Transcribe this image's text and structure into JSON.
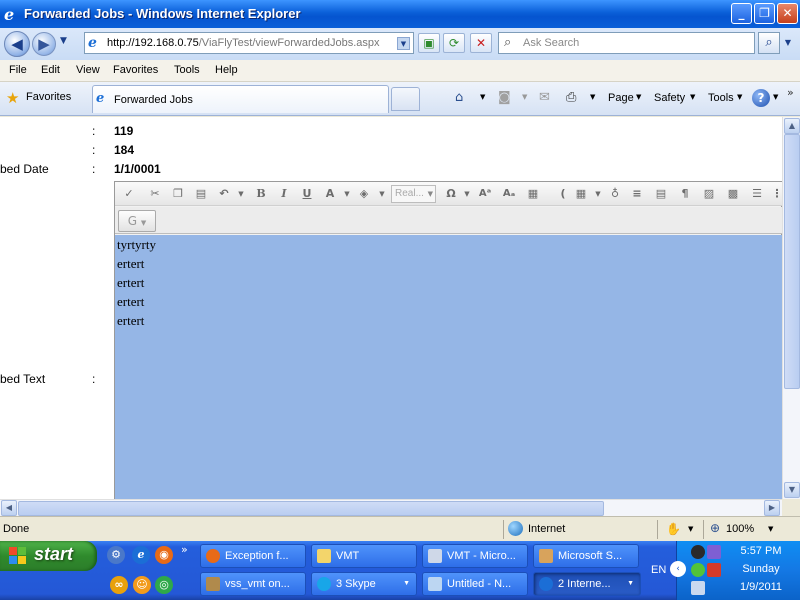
{
  "window": {
    "title": "Forwarded Jobs - Windows Internet Explorer",
    "minimize": "_",
    "restore": "❐",
    "close": "✕"
  },
  "address": {
    "url_host": "http://192.168.0.75",
    "url_path": "/ViaFlyTest/viewForwardedJobs.aspx",
    "search_placeholder": "Ask Search"
  },
  "menu": [
    "File",
    "Edit",
    "View",
    "Favorites",
    "Tools",
    "Help"
  ],
  "favorites": {
    "label": "Favorites",
    "tab_title": "Forwarded Jobs"
  },
  "commandbar": {
    "page": "Page",
    "safety": "Safety",
    "tools": "Tools"
  },
  "content": {
    "rows": [
      {
        "label": "",
        "colon": ":",
        "value": "119"
      },
      {
        "label": "",
        "colon": ":",
        "value": "184"
      },
      {
        "label": "bed Date",
        "colon": ":",
        "value": "1/1/0001"
      }
    ],
    "text_label": "bed Text",
    "text_colon": ":",
    "font_select": "Real...",
    "editor_lines": [
      "tyrtyrty",
      "ertert",
      "ertert",
      "ertert",
      "ertert"
    ]
  },
  "status": {
    "text": "Done",
    "zone": "Internet",
    "zoom": "100%"
  },
  "taskbar": {
    "start": "start",
    "tasks_row1": [
      "Exception f...",
      "VMT",
      "VMT - Micro...",
      "Microsoft S..."
    ],
    "tasks_row2": [
      "vss_vmt on...",
      "3 Skype",
      "Untitled - N...",
      "2 Interne..."
    ],
    "lang": "EN",
    "time": "5:57 PM",
    "day": "Sunday",
    "date": "1/9/2011"
  },
  "colors": {
    "editor_selection": "#95b6e6",
    "titlebar": "#0a5fd8"
  }
}
